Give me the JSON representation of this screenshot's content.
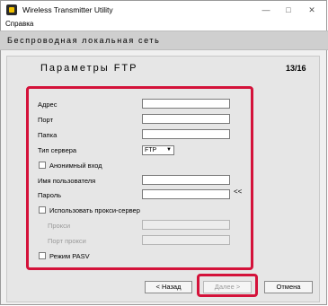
{
  "window": {
    "title": "Wireless Transmitter Utility",
    "min_glyph": "—",
    "max_glyph": "□",
    "close_glyph": "✕"
  },
  "menu": {
    "help": "Справка"
  },
  "header": {
    "title": "Беспроводная локальная сеть"
  },
  "page": {
    "title": "Параметры FTP",
    "counter": "13/16"
  },
  "form": {
    "address_label": "Адрес",
    "address_value": "",
    "port_label": "Порт",
    "port_value": "",
    "folder_label": "Папка",
    "folder_value": "",
    "server_type_label": "Тип сервера",
    "server_type_value": "FTP",
    "anonymous_label": "Анонимный вход",
    "anonymous_checked": false,
    "username_label": "Имя пользователя",
    "username_value": "",
    "password_label": "Пароль",
    "password_value": "",
    "reveal_label": "<<",
    "use_proxy_label": "Использовать прокси-сервер",
    "use_proxy_checked": false,
    "proxy_label": "Прокси",
    "proxy_value": "",
    "proxy_port_label": "Порт прокси",
    "proxy_port_value": "",
    "pasv_label": "Режим PASV",
    "pasv_checked": false
  },
  "buttons": {
    "back": "< Назад",
    "next": "Далее >",
    "cancel": "Отмена"
  },
  "colors": {
    "highlight": "#d4123a"
  }
}
